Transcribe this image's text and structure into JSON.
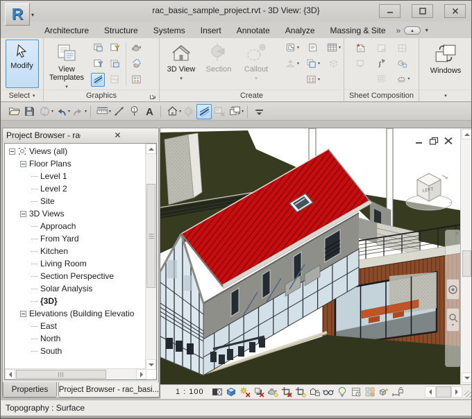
{
  "window": {
    "title": "rac_basic_sample_project.rvt - 3D View: {3D}",
    "app_letter": "R"
  },
  "tabs": [
    {
      "label": "Architecture"
    },
    {
      "label": "Structure"
    },
    {
      "label": "Systems"
    },
    {
      "label": "Insert"
    },
    {
      "label": "Annotate"
    },
    {
      "label": "Analyze"
    },
    {
      "label": "Massing & Site"
    }
  ],
  "tab_overflow": {
    "chevrons": "»",
    "minimize_glyph": "▴",
    "dropdown_glyph": "▾"
  },
  "ribbon": {
    "select_panel": {
      "modify_label": "Modify",
      "panel_label": "Select",
      "dropdown_glyph": "▾"
    },
    "graphics_panel": {
      "view_templates_label": "View Templates",
      "panel_label": "Graphics",
      "buttons": [
        {
          "name": "visibility-graphics"
        },
        {
          "name": "filters"
        },
        {
          "name": "hide-by-filter"
        },
        {
          "name": "apply-filter"
        },
        {
          "name": "thin-lines",
          "highlight": true
        },
        {
          "name": "cut-profile",
          "disabled": true
        }
      ],
      "render_buttons": [
        {
          "name": "render"
        },
        {
          "name": "render-in-cloud"
        },
        {
          "name": "render-gallery"
        }
      ]
    },
    "create_panel": {
      "panel_label": "Create",
      "big_buttons": [
        {
          "label": "3D View",
          "name": "3d-view",
          "dropdown": true,
          "disabled": false
        },
        {
          "label": "Section",
          "name": "section",
          "dropdown": false,
          "disabled": true
        },
        {
          "label": "Callout",
          "name": "callout",
          "dropdown": true,
          "disabled": true
        }
      ],
      "small_buttons": [
        {
          "name": "plan-views",
          "dd": true
        },
        {
          "name": "drafting-view"
        },
        {
          "name": "schedules",
          "dd": true
        },
        {
          "name": "elevation",
          "dd": true,
          "disabled": true
        },
        {
          "name": "duplicate-view",
          "dd": true
        },
        {
          "name": "scope-box",
          "disabled": true
        },
        {
          "spacer": true
        },
        {
          "name": "legends",
          "dd": true
        },
        {
          "spacer": true
        }
      ]
    },
    "sheet_panel": {
      "panel_label": "Sheet Composition",
      "small_buttons": [
        {
          "name": "new-sheet"
        },
        {
          "name": "titleblock",
          "disabled": true
        },
        {
          "name": "sheet-view",
          "disabled": true
        },
        {
          "name": "place-view",
          "disabled": true
        },
        {
          "name": "matchline"
        },
        {
          "name": "view-reference"
        },
        {
          "spacer": true
        },
        {
          "name": "guide-grid"
        },
        {
          "name": "revisions",
          "dd": true
        }
      ]
    },
    "windows_panel": {
      "label": "Windows",
      "panel_dropdown_glyph": "▾"
    }
  },
  "qat": {
    "items": [
      {
        "name": "open"
      },
      {
        "name": "save"
      },
      {
        "name": "synchronize",
        "disabled": true,
        "dd": true
      },
      {
        "name": "undo",
        "dd": true
      },
      {
        "name": "redo",
        "disabled": true,
        "dd": true
      },
      {
        "sep": true
      },
      {
        "name": "measure",
        "dd": true
      },
      {
        "name": "aligned-dimension"
      },
      {
        "name": "tag-by-category"
      },
      {
        "name": "text"
      },
      {
        "sep": true
      },
      {
        "name": "default-3d-view",
        "dd": true
      },
      {
        "name": "section",
        "disabled": true
      },
      {
        "name": "thin-lines",
        "highlight": true
      },
      {
        "name": "close-hidden-windows",
        "disabled": true
      },
      {
        "name": "switch-windows",
        "dd": true
      },
      {
        "sep": true
      },
      {
        "name": "customize-qat"
      }
    ]
  },
  "browser": {
    "title": "Project Browser - rac_basic_sample_...",
    "close_glyph": "✕",
    "tree": [
      {
        "label": "Views (all)",
        "level": 0,
        "exp": true,
        "icon": true
      },
      {
        "label": "Floor Plans",
        "level": 1,
        "exp": true
      },
      {
        "label": "Level 1",
        "level": 2
      },
      {
        "label": "Level 2",
        "level": 2
      },
      {
        "label": "Site",
        "level": 2
      },
      {
        "label": "3D Views",
        "level": 1,
        "exp": true
      },
      {
        "label": "Approach",
        "level": 2
      },
      {
        "label": "From Yard",
        "level": 2
      },
      {
        "label": "Kitchen",
        "level": 2
      },
      {
        "label": "Living Room",
        "level": 2
      },
      {
        "label": "Section Perspective",
        "level": 2
      },
      {
        "label": "Solar Analysis",
        "level": 2
      },
      {
        "label": "{3D}",
        "level": 2,
        "bold": true
      },
      {
        "label": "Elevations (Building Elevatio",
        "level": 1,
        "exp": true
      },
      {
        "label": "East",
        "level": 2
      },
      {
        "label": "North",
        "level": 2
      },
      {
        "label": "South",
        "level": 2
      }
    ]
  },
  "panel_tabs": [
    {
      "label": "Properties",
      "active": false
    },
    {
      "label": "Project Browser - rac_basi...",
      "active": true
    }
  ],
  "view_window": {
    "scale_label": "1 : 100",
    "viewcube_face": "LEFT",
    "viewbar_items": [
      {
        "name": "detail-level"
      },
      {
        "name": "visual-style"
      },
      {
        "name": "sun-path"
      },
      {
        "name": "shadows"
      },
      {
        "name": "render-dialog"
      },
      {
        "name": "crop-view"
      },
      {
        "name": "show-crop"
      },
      {
        "name": "unlocked-3d"
      },
      {
        "name": "temp-hide"
      },
      {
        "name": "reveal-hidden"
      },
      {
        "name": "temp-view-props"
      },
      {
        "name": "worksharing"
      },
      {
        "name": "displacement"
      },
      {
        "name": "reveal-constraints"
      }
    ]
  },
  "statusbar": {
    "text": "Topography : Surface"
  }
}
